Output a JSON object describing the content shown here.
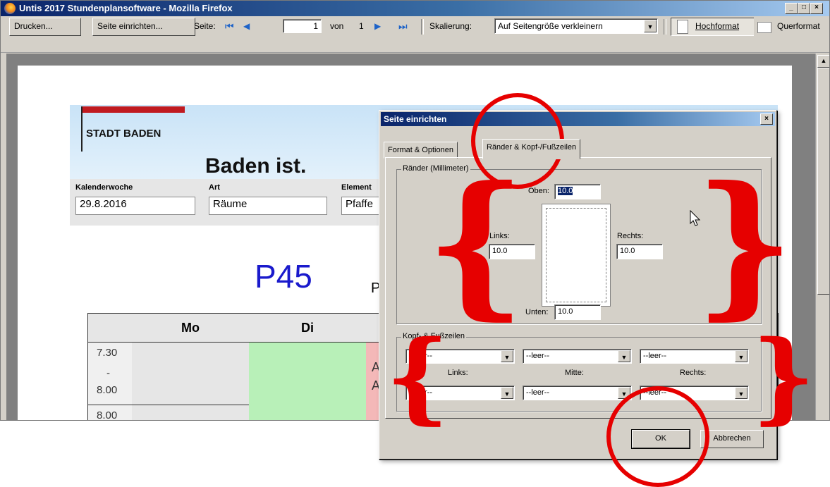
{
  "window": {
    "title": "Untis 2017 Stundenplansoftware - Mozilla Firefox",
    "controls": [
      "_",
      "□",
      "×"
    ]
  },
  "toolbar": {
    "print_label": "Drucken...",
    "page_setup_label": "Seite einrichten...",
    "page_label": "Seite:",
    "page_value": "1",
    "of_label": "von",
    "of_value": "1",
    "scale_label": "Skalierung:",
    "scale_value": "Auf Seitengröße verkleinern",
    "portrait_label": "Hochformat",
    "landscape_label": "Querformat"
  },
  "document": {
    "brand": "STADT BADEN",
    "slogan": "Baden ist.",
    "week_label": "Kalenderwoche",
    "week_value": "29.8.2016",
    "type_label": "Art",
    "type_value": "Räume",
    "element_label": "Element",
    "element_value": "Pfaffe",
    "room": "P45",
    "room_tail": "P",
    "days": [
      "Mo",
      "Di"
    ],
    "time_start": "7.30",
    "time_dash": "-",
    "time_end": "8.00",
    "time_next": "8.00",
    "lesson_a1": "A",
    "lesson_a2": "A"
  },
  "dialog": {
    "title": "Seite einrichten",
    "tab_format": "Format & Optionen",
    "tab_margins": "Ränder & Kopf-/Fußzeilen",
    "margins_group": "Ränder (Millimeter)",
    "top_label": "Oben:",
    "top_value": "10.0",
    "left_label": "Links:",
    "left_value": "10.0",
    "right_label": "Rechts:",
    "right_value": "10.0",
    "bottom_label": "Unten:",
    "bottom_value": "10.0",
    "hf_group": "Kopf- & Fußzeilen",
    "header_left": "--leer--",
    "header_center": "--leer--",
    "header_right": "--leer--",
    "col_left": "Links:",
    "col_center": "Mitte:",
    "col_right": "Rechts:",
    "footer_left": "--leer--",
    "footer_center": "--leer--",
    "footer_right": "--leer--",
    "ok_label": "OK",
    "cancel_label": "Abbrechen",
    "close_glyph": "×"
  },
  "colors": {
    "annotation": "#e60000",
    "titlebar": "#0a246a",
    "banner": "#c9e3f7",
    "brand_red": "#c01a20",
    "room_blue": "#1a1acc",
    "di_column": "#b8f0b8",
    "mi_column": "#f4b8b8"
  }
}
